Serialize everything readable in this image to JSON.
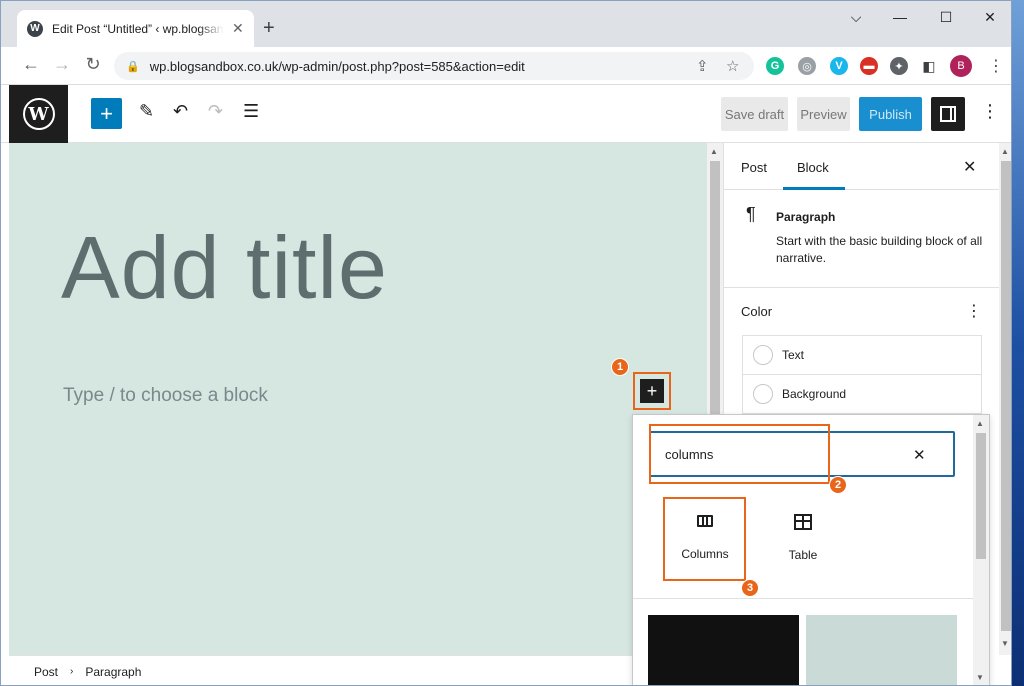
{
  "browser": {
    "tab_title": "Edit Post “Untitled” ‹ wp.blogsandbox.co.uk",
    "tab_favicon": "W",
    "new_tab": "+",
    "minimize": "⌵",
    "restore": "—",
    "maximize": "☐",
    "close": "✕",
    "url": "wp.blogsandbox.co.uk/wp-admin/post.php?post=585&action=edit",
    "profile_initial": "B",
    "extensions": [
      {
        "name": "grammarly-icon",
        "glyph": "G",
        "color": "#15c39a"
      },
      {
        "name": "shield-icon",
        "glyph": "◎",
        "color": "#9aa0a6"
      },
      {
        "name": "vimeo-icon",
        "glyph": "V",
        "color": "#1ab7ea"
      },
      {
        "name": "recorder-icon",
        "glyph": "▬",
        "color": "#d93025"
      },
      {
        "name": "puzzle-icon",
        "glyph": "✦",
        "color": "#5f6368"
      }
    ]
  },
  "wp_header": {
    "logo": "W",
    "add_block": "+",
    "tools_icon": "✎",
    "undo_icon": "↶",
    "redo_icon": "↷",
    "list_view_icon": "☰",
    "save_draft": "Save draft",
    "preview": "Preview",
    "publish": "Publish",
    "more": "⋮"
  },
  "canvas": {
    "title_placeholder": "Add title",
    "paragraph_placeholder": "Type / to choose a block",
    "inserter_glyph": "+",
    "badge1": "1"
  },
  "sidebar": {
    "tabs": [
      "Post",
      "Block"
    ],
    "active_tab": "Block",
    "close": "✕",
    "block": {
      "icon": "¶",
      "name": "Paragraph",
      "description": "Start with the basic building block of all narrative."
    },
    "color": {
      "title": "Color",
      "more": "⋮",
      "options": [
        "Text",
        "Background"
      ]
    }
  },
  "footer": {
    "crumbs": [
      "Post",
      "Paragraph"
    ],
    "separator": "›"
  },
  "inserter": {
    "search_value": "columns",
    "clear": "✕",
    "badge2": "2",
    "badge3": "3",
    "results": [
      {
        "label": "Columns",
        "icon": "columns-icon"
      },
      {
        "label": "Table",
        "icon": "table-icon"
      }
    ]
  },
  "colors": {
    "accent": "#007cba",
    "annotation": "#e8651a",
    "canvas_bg": "#d6e6e1"
  }
}
